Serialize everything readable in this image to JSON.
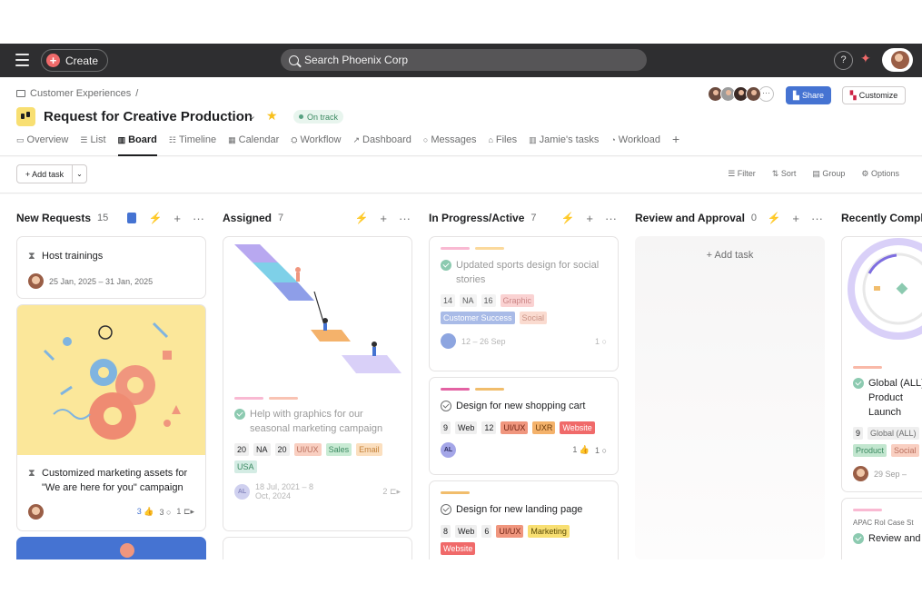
{
  "topbar": {
    "create_label": "Create",
    "search_placeholder": "Search Phoenix Corp",
    "help": "?"
  },
  "header": {
    "breadcrumb": "Customer Experiences",
    "breadcrumb_sep": "/",
    "title": "Request for Creative Production",
    "status": "On track",
    "share_label": "Share",
    "customize_label": "Customize",
    "more_members": "···"
  },
  "tabs": [
    {
      "icon": "▭",
      "label": "Overview"
    },
    {
      "icon": "☰",
      "label": "List"
    },
    {
      "icon": "▥",
      "label": "Board"
    },
    {
      "icon": "☷",
      "label": "Timeline"
    },
    {
      "icon": "▦",
      "label": "Calendar"
    },
    {
      "icon": "⛭",
      "label": "Workflow"
    },
    {
      "icon": "↗",
      "label": "Dashboard"
    },
    {
      "icon": "○",
      "label": "Messages"
    },
    {
      "icon": "⌂",
      "label": "Files"
    },
    {
      "icon": "▥",
      "label": "Jamie's tasks"
    },
    {
      "icon": "◔",
      "label": "Workload"
    }
  ],
  "toolbar": {
    "add_task": "+ Add task",
    "filter": "Filter",
    "sort": "Sort",
    "group": "Group",
    "options": "Options"
  },
  "columns": [
    {
      "name": "New Requests",
      "count": "15"
    },
    {
      "name": "Assigned",
      "count": "7"
    },
    {
      "name": "In Progress/Active",
      "count": "7"
    },
    {
      "name": "Review and Approval",
      "count": "0"
    },
    {
      "name": "Recently Comple"
    }
  ],
  "col1": {
    "card1": {
      "title": "Host trainings",
      "dates": "25 Jan, 2025 – 31 Jan, 2025"
    },
    "card2": {
      "title": "Customized marketing assets for \"We are here for you\" campaign",
      "likes": "3",
      "comments": "3",
      "subtasks": "1"
    }
  },
  "col2": {
    "card1": {
      "title": "Help with graphics for our seasonal marketing campaign",
      "tags": [
        "20",
        "NA",
        "20",
        "UI/UX",
        "Sales",
        "Email",
        "USA"
      ],
      "assignee": "AL",
      "dates": "18 Jul, 2021 – 8 Oct, 2024",
      "subtasks": "2"
    }
  },
  "col3": {
    "card1": {
      "title": "Updated sports design for social stories",
      "tags": [
        "14",
        "NA",
        "16",
        "Graphic",
        "Customer Success",
        "Social"
      ],
      "dates": "12 – 26 Sep",
      "comments": "1"
    },
    "card2": {
      "title": "Design for new shopping cart",
      "tags": [
        "9",
        "Web",
        "12",
        "UI/UX",
        "UXR",
        "Website"
      ],
      "assignee": "AL",
      "likes": "1",
      "comments": "1"
    },
    "card3": {
      "title": "Design for new landing page",
      "tags": [
        "8",
        "Web",
        "6",
        "UI/UX",
        "Marketing",
        "Website"
      ]
    }
  },
  "col4": {
    "add_task": "+ Add task"
  },
  "col5": {
    "card1": {
      "title": "Global (ALL) Product Launch",
      "tags": [
        "9",
        "Global (ALL)",
        "Product",
        "Social"
      ],
      "dates": "29 Sep –"
    },
    "card2": {
      "title": "APAC RoI Case St",
      "subtitle": "Review and"
    }
  },
  "colors": {
    "topbar": "#2e2e30",
    "accent": "#f06a6a",
    "share": "#4573d2",
    "bolt": "#f1bd6c"
  }
}
